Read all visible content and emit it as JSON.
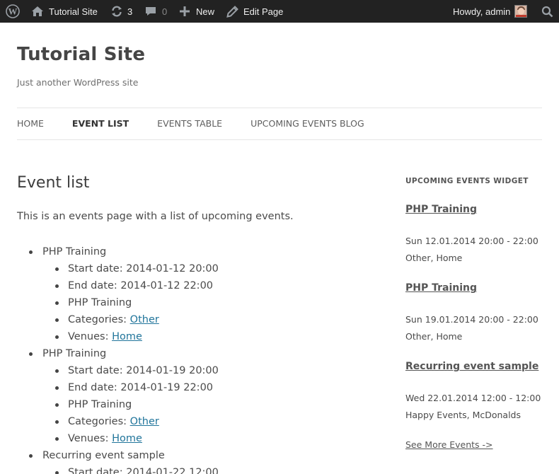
{
  "adminbar": {
    "site_name": "Tutorial Site",
    "updates_count": "3",
    "comments_count": "0",
    "new_label": "New",
    "edit_label": "Edit Page",
    "howdy": "Howdy, admin"
  },
  "header": {
    "title": "Tutorial Site",
    "description": "Just another WordPress site"
  },
  "nav": {
    "items": [
      {
        "label": "HOME"
      },
      {
        "label": "EVENT LIST"
      },
      {
        "label": "EVENTS TABLE"
      },
      {
        "label": "UPCOMING EVENTS BLOG"
      }
    ]
  },
  "main": {
    "title": "Event list",
    "intro": "This is an events page with a list of upcoming events.",
    "events": [
      {
        "name": "PHP Training",
        "start": "Start date: 2014-01-12 20:00",
        "end": "End date: 2014-01-12 22:00",
        "desc": "PHP Training",
        "categories_label": "Categories: ",
        "category": "Other",
        "venues_label": "Venues: ",
        "venue": "Home"
      },
      {
        "name": "PHP Training",
        "start": "Start date: 2014-01-19 20:00",
        "end": "End date: 2014-01-19 22:00",
        "desc": "PHP Training",
        "categories_label": "Categories: ",
        "category": "Other",
        "venues_label": "Venues: ",
        "venue": "Home"
      },
      {
        "name": "Recurring event sample",
        "start": "Start date: 2014-01-22 12:00"
      }
    ]
  },
  "widget": {
    "title": "UPCOMING EVENTS WIDGET",
    "events": [
      {
        "title": "PHP Training",
        "date": "Sun 12.01.2014 20:00 - 22:00",
        "venue": "Other, Home"
      },
      {
        "title": "PHP Training",
        "date": "Sun 19.01.2014 20:00 - 22:00",
        "venue": "Other, Home"
      },
      {
        "title": "Recurring event sample",
        "date": "Wed 22.01.2014 12:00 - 12:00",
        "venue": "Happy Events, McDonalds"
      }
    ],
    "see_more": "See More Events ->"
  },
  "icons": {
    "wordpress": "wordpress-logo-icon",
    "home": "home-icon",
    "updates": "updates-icon",
    "comments": "comment-bubble-icon",
    "new": "plus-icon",
    "edit": "pencil-icon",
    "search": "search-icon"
  }
}
